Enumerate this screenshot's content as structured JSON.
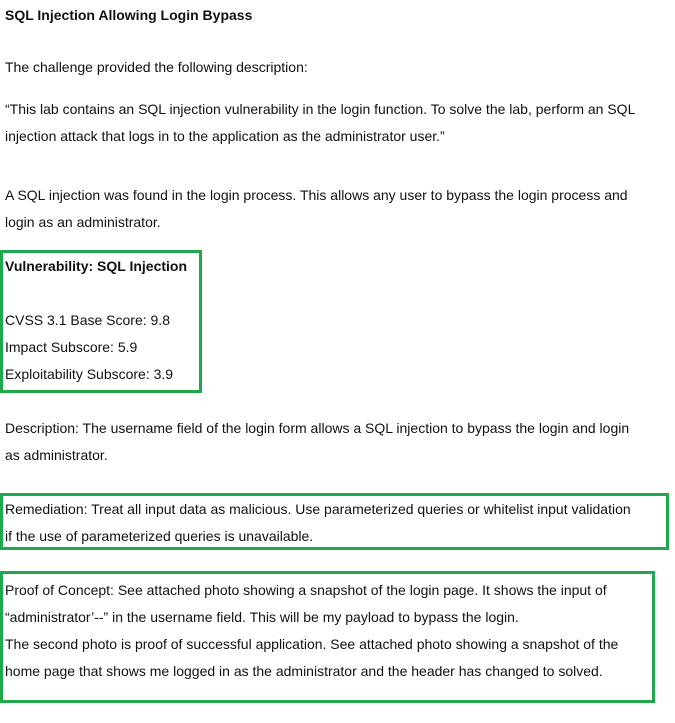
{
  "title": "SQL Injection Allowing Login Bypass",
  "intro": "The challenge provided the following description:",
  "quote": {
    "line1": "“This lab contains an SQL injection vulnerability in the login function. To solve the lab, perform an SQL",
    "line2": "injection attack that logs in to the application as the administrator user.”"
  },
  "finding": {
    "line1": "A SQL injection was found in the login process. This allows any user to bypass the login process and",
    "line2": "login as an administrator."
  },
  "vulnerability": {
    "heading": "Vulnerability: SQL Injection",
    "cvss": "CVSS 3.1 Base Score: 9.8",
    "impact": "Impact Subscore: 5.9",
    "exploitability": "Exploitability Subscore: 3.9"
  },
  "description": {
    "line1": "Description: The username field of the login form allows a SQL injection to bypass the login and login",
    "line2": "as administrator."
  },
  "remediation": {
    "line1": "Remediation: Treat all input data as malicious. Use parameterized queries or whitelist input validation",
    "line2": "if the use of parameterized queries is unavailable."
  },
  "proof": {
    "line1": "Proof of Concept: See attached photo showing a snapshot of the login page. It shows the input of",
    "line2": "“administrator’--” in the username field. This will be my payload to bypass the login.",
    "line3": "The second photo is proof of successful application. See attached photo showing a snapshot of the",
    "line4": "home page that shows me logged in as the administrator and the header has changed to solved."
  },
  "colors": {
    "highlight_box": "#21a84e",
    "text": "#111111"
  }
}
